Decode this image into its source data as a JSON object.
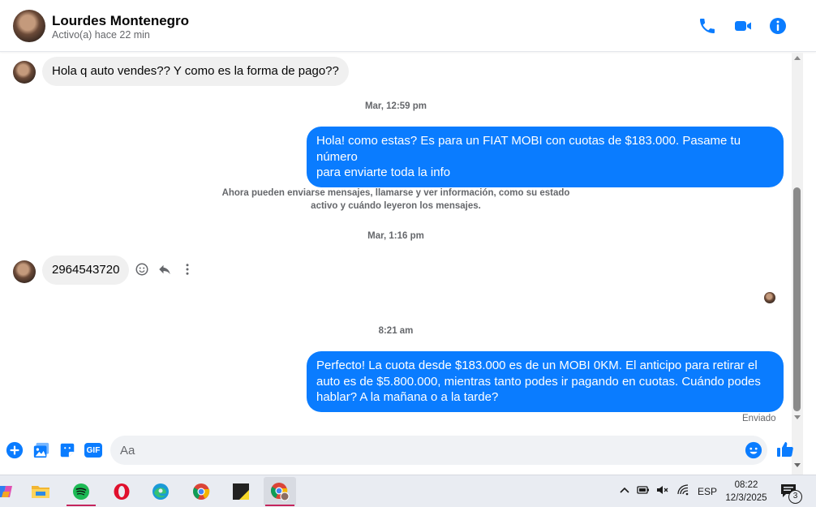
{
  "header": {
    "contact_name": "Lourdes Montenegro",
    "status": "Activo(a) hace 22 min",
    "icons": [
      "phone-icon",
      "video-camera-icon",
      "info-icon"
    ]
  },
  "conversation": {
    "msg1": "Hola q auto vendes?? Y como es la forma de pago??",
    "ts1": "Mar, 12:59 pm",
    "msg2_line1": "Hola! como estas? Es para un FIAT MOBI con cuotas de $183.000. Pasame tu número",
    "msg2_line2": "para enviarte toda la info",
    "system_line1": "Ahora pueden enviarse mensajes, llamarse y ver información, como su estado",
    "system_line2": "activo y cuándo leyeron los mensajes.",
    "ts2": "Mar, 1:16 pm",
    "msg3": "2964543720",
    "ts3": "8:21 am",
    "msg4_line1": "Perfecto! La cuota desde $183.000 es de un MOBI 0KM. El anticipo para retirar el",
    "msg4_line2": "auto es de $5.800.000, mientras tanto podes ir pagando en cuotas. Cuándo podes",
    "msg4_line3": "hablar? A la mañana o a la tarde?",
    "sent_status": "Enviado"
  },
  "composer": {
    "placeholder": "Aa",
    "gif_label": "GIF",
    "icons": [
      "plus-icon",
      "photo-icon",
      "sticker-icon",
      "gif-icon",
      "emoji-icon",
      "thumbs-up-icon"
    ]
  },
  "taskbar": {
    "apps": [
      "copilot-icon",
      "file-explorer-icon",
      "spotify-icon",
      "opera-icon",
      "edge-icon",
      "chrome-icon",
      "sticky-notes-icon",
      "chrome-profile-icon"
    ],
    "language": "ESP",
    "time": "08:22",
    "date": "12/3/2025",
    "notification_count": "3"
  },
  "colors": {
    "accent": "#0a7cff",
    "incoming_bubble": "#f0f0f0",
    "taskbar_bg": "#e9ecf2"
  }
}
